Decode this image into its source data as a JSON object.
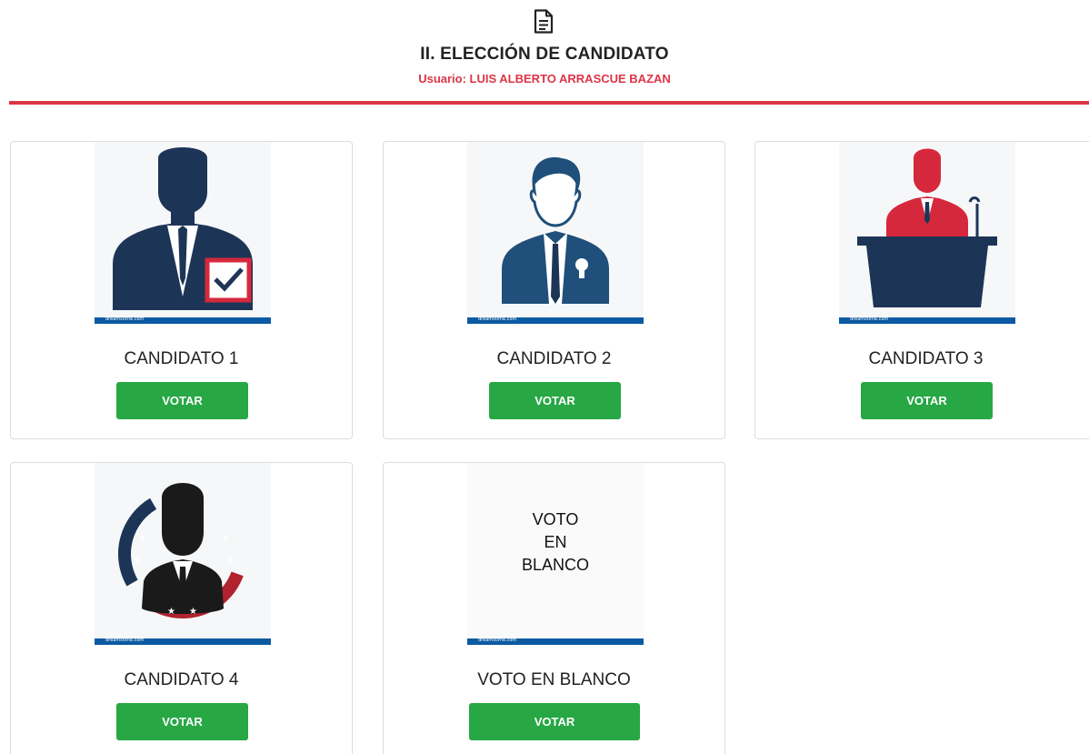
{
  "header": {
    "icon": "document-icon",
    "title": "II. ELECCIÓN DE CANDIDATO",
    "user_label": "Usuario: LUIS ALBERTO ARRASCUE BAZAN"
  },
  "colors": {
    "accent_red": "#dc3545",
    "vote_green": "#28a745",
    "silhouette_navy": "#1c3557",
    "watermark_blue": "#0b5aa2"
  },
  "watermark": "dreamstime.com",
  "candidates": [
    {
      "name": "CANDIDATO 1",
      "button": "VOTAR",
      "icon": "candidate-checkmark-icon"
    },
    {
      "name": "CANDIDATO 2",
      "button": "VOTAR",
      "icon": "candidate-ribbon-icon"
    },
    {
      "name": "CANDIDATO 3",
      "button": "VOTAR",
      "icon": "candidate-podium-icon"
    },
    {
      "name": "CANDIDATO 4",
      "button": "VOTAR",
      "icon": "candidate-stars-icon"
    },
    {
      "name": "VOTO EN BLANCO",
      "button": "VOTAR",
      "image_text": [
        "VOTO",
        "EN",
        "BLANCO"
      ]
    }
  ]
}
